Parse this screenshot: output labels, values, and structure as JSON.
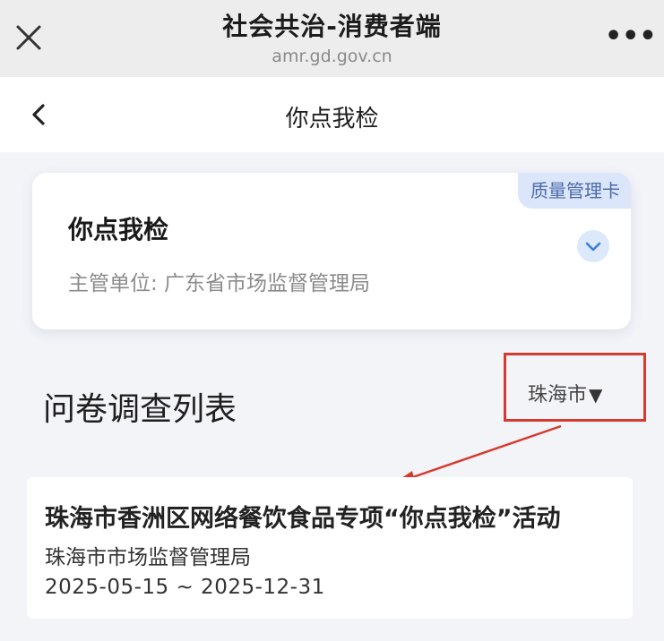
{
  "browser": {
    "title": "社会共治-消费者端",
    "url": "amr.gd.gov.cn",
    "more_label": "•••"
  },
  "nav": {
    "title": "你点我检"
  },
  "card": {
    "badge": "质量管理卡",
    "title": "你点我检",
    "subtitle": "主管单位: 广东省市场监督管理局"
  },
  "section": {
    "title": "问卷调查列表",
    "city": "珠海市",
    "city_arrow": "▼"
  },
  "list": [
    {
      "title": "珠海市香洲区网络餐饮食品专项“你点我检”活动",
      "org": "珠海市市场监督管理局",
      "date": "2025-05-15 ~ 2025-12-31"
    }
  ],
  "colors": {
    "highlight": "#d63a2f",
    "badge_bg": "#dbe6fb",
    "badge_text": "#4a6aa8"
  }
}
